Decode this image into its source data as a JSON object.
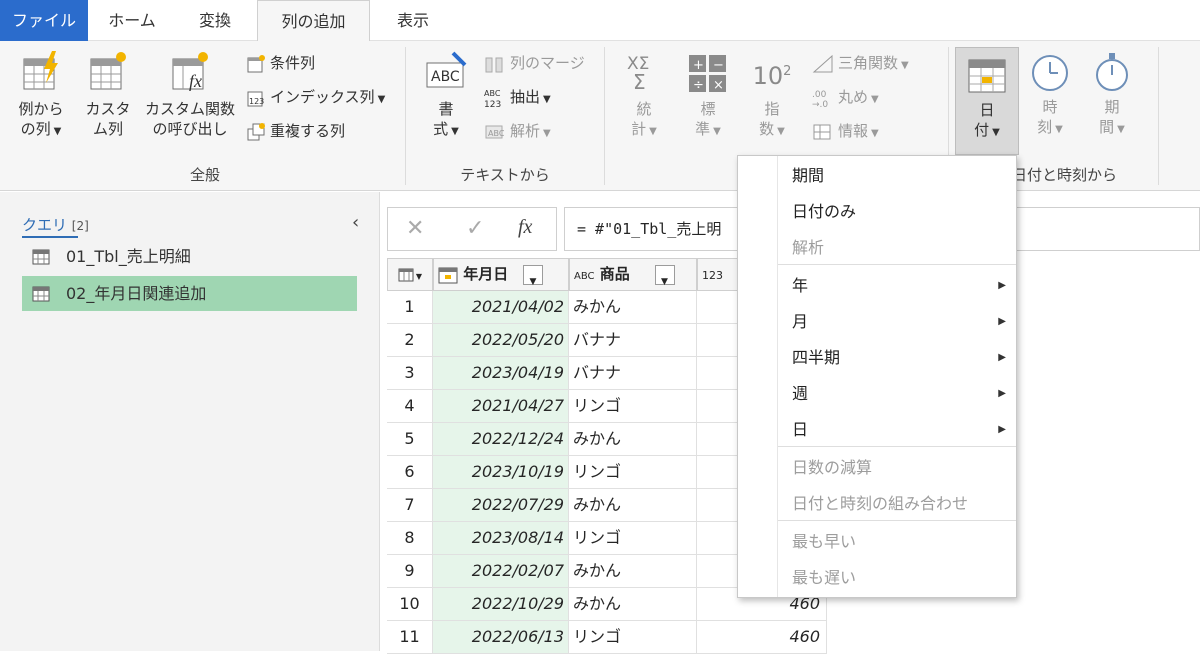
{
  "tabs": [
    "ファイル",
    "ホーム",
    "変換",
    "列の追加",
    "表示"
  ],
  "ribbon": {
    "general": {
      "label": "全般",
      "example_col": [
        "例から",
        "の列"
      ],
      "custom_col": [
        "カスタ",
        "ム列"
      ],
      "custom_fn": [
        "カスタム関数",
        "の呼び出し"
      ],
      "conditional": "条件列",
      "index": "インデックス列",
      "duplicate": "重複する列"
    },
    "text": {
      "label": "テキストから",
      "format": [
        "書",
        "式"
      ],
      "merge": "列のマージ",
      "extract": "抽出",
      "parse": "解析"
    },
    "number": {
      "stats": [
        "統",
        "計"
      ],
      "standard": [
        "標",
        "準"
      ],
      "scientific": [
        "指",
        "数"
      ],
      "sci_icon": "10",
      "sci_icon_sup": "2",
      "trig": "三角関数",
      "rounding": "丸め",
      "info": "情報"
    },
    "datetime": {
      "label": "日付と時刻から",
      "date": [
        "日",
        "付"
      ],
      "time": [
        "時",
        "刻"
      ],
      "duration": [
        "期",
        "間"
      ]
    }
  },
  "queries": {
    "title": "クエリ",
    "count": "[2]",
    "items": [
      "01_Tbl_売上明細",
      "02_年月日関連追加"
    ]
  },
  "formula_bar": {
    "fx": "fx",
    "text": "= #\"01_Tbl_売上明"
  },
  "table": {
    "columns": [
      "年月日",
      "商品"
    ],
    "prod_type_icon": "ABC",
    "val_type_icon": "123",
    "rows": [
      {
        "n": "1",
        "date": "2021/04/02",
        "prod": "みかん",
        "val": ""
      },
      {
        "n": "2",
        "date": "2022/05/20",
        "prod": "バナナ",
        "val": ""
      },
      {
        "n": "3",
        "date": "2023/04/19",
        "prod": "バナナ",
        "val": ""
      },
      {
        "n": "4",
        "date": "2021/04/27",
        "prod": "リンゴ",
        "val": ""
      },
      {
        "n": "5",
        "date": "2022/12/24",
        "prod": "みかん",
        "val": ""
      },
      {
        "n": "6",
        "date": "2023/10/19",
        "prod": "リンゴ",
        "val": ""
      },
      {
        "n": "7",
        "date": "2022/07/29",
        "prod": "みかん",
        "val": ""
      },
      {
        "n": "8",
        "date": "2023/08/14",
        "prod": "リンゴ",
        "val": ""
      },
      {
        "n": "9",
        "date": "2022/02/07",
        "prod": "みかん",
        "val": ""
      },
      {
        "n": "10",
        "date": "2022/10/29",
        "prod": "みかん",
        "val": "460"
      },
      {
        "n": "11",
        "date": "2022/06/13",
        "prod": "リンゴ",
        "val": "460"
      }
    ]
  },
  "menu": {
    "items": [
      {
        "label": "期間",
        "enabled": true,
        "submenu": false
      },
      {
        "label": "日付のみ",
        "enabled": true,
        "submenu": false
      },
      {
        "label": "解析",
        "enabled": false,
        "submenu": false
      },
      {
        "label": "年",
        "enabled": true,
        "submenu": true
      },
      {
        "label": "月",
        "enabled": true,
        "submenu": true
      },
      {
        "label": "四半期",
        "enabled": true,
        "submenu": true
      },
      {
        "label": "週",
        "enabled": true,
        "submenu": true
      },
      {
        "label": "日",
        "enabled": true,
        "submenu": true
      },
      {
        "label": "日数の減算",
        "enabled": false,
        "submenu": false
      },
      {
        "label": "日付と時刻の組み合わせ",
        "enabled": false,
        "submenu": false
      },
      {
        "label": "最も早い",
        "enabled": false,
        "submenu": false
      },
      {
        "label": "最も遅い",
        "enabled": false,
        "submenu": false
      }
    ]
  },
  "colors": {
    "file_tab": "#2b6ccc",
    "selected_query": "#9fd6b2",
    "date_column": "#e6f5ea",
    "link": "#2f6db5"
  }
}
